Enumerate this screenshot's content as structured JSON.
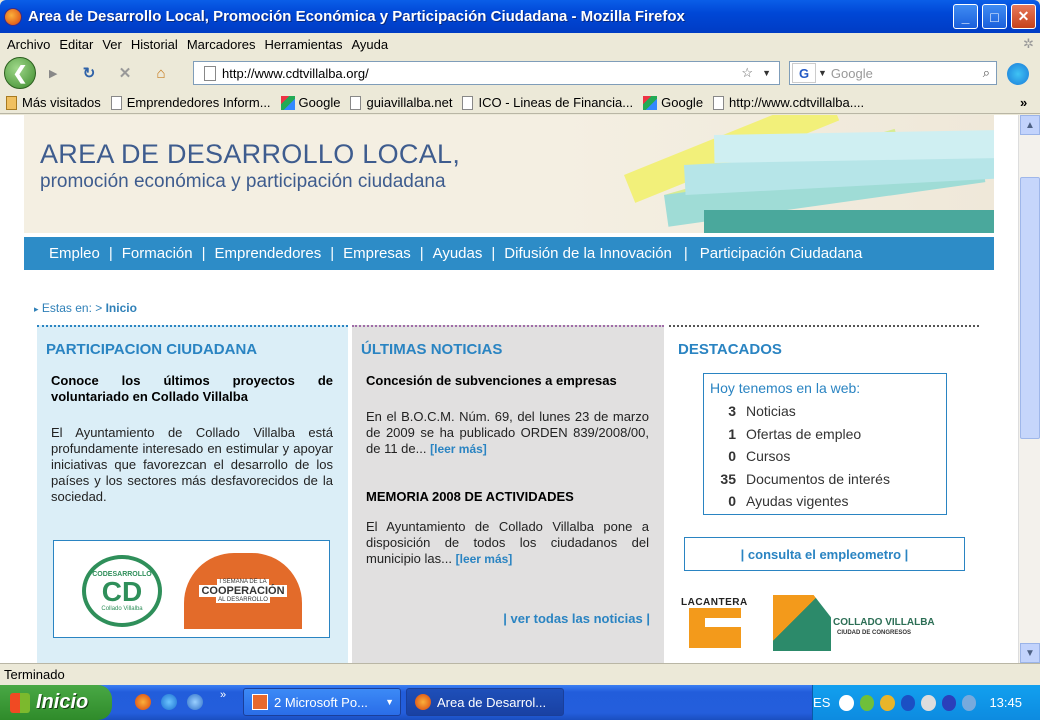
{
  "window": {
    "title": "Area de Desarrollo Local, Promoción Económica y Participación Ciudadana - Mozilla Firefox"
  },
  "menu": [
    "Archivo",
    "Editar",
    "Ver",
    "Historial",
    "Marcadores",
    "Herramientas",
    "Ayuda"
  ],
  "navigation": {
    "url": "http://www.cdtvillalba.org/",
    "search_placeholder": "Google"
  },
  "bookmarks": [
    {
      "label": "Más visitados",
      "icon": "folder-icon"
    },
    {
      "label": "Emprendedores Inform...",
      "icon": "page-icon"
    },
    {
      "label": "Google",
      "icon": "google-icon"
    },
    {
      "label": "guiavillalba.net",
      "icon": "page-icon"
    },
    {
      "label": "ICO - Lineas de Financia...",
      "icon": "page-icon"
    },
    {
      "label": "Google",
      "icon": "google-icon"
    },
    {
      "label": "http://www.cdtvillalba....",
      "icon": "page-icon"
    }
  ],
  "banner": {
    "title": "AREA DE DESARROLLO LOCAL,",
    "subtitle": "promoción económica y participación ciudadana"
  },
  "topnav": [
    "Empleo",
    "Formación",
    "Emprendedores",
    "Empresas",
    "Ayudas",
    "Difusión de la Innovación",
    "Participación Ciudadana"
  ],
  "breadcrumb": {
    "prefix": "Estas en: >",
    "current": "Inicio"
  },
  "participacion": {
    "heading": "PARTICIPACION CIUDADANA",
    "title": "Conoce los últimos proyectos de voluntariado en Collado Villalba",
    "body": "El Ayuntamiento de Collado Villalba está profundamente interesado en estimular y apoyar iniciativas que favorezcan el desarrollo de los países y los sectores más desfavorecidos de la sociedad.",
    "logo1_text": "CODESARROLLO",
    "logo1_sub": "Collado Villalba",
    "logo2_top": "I SEMANA DE LA",
    "logo2_main": "COOPERACIÓN",
    "logo2_sub": "AL DESARROLLO"
  },
  "noticias": {
    "heading": "ÚLTIMAS NOTICIAS",
    "items": [
      {
        "title": "Concesión de subvenciones a empresas",
        "body": "En el B.O.C.M. Núm. 69, del lunes 23 de marzo de 2009 se ha publicado ORDEN 839/2008/00, de 11 de...",
        "more": "[leer más]"
      },
      {
        "title": "MEMORIA 2008 DE ACTIVIDADES",
        "body": "El Ayuntamiento de Collado Villalba pone a disposición de todos los ciudadanos del municipio las...",
        "more": "[leer más]"
      }
    ],
    "all_link": "| ver todas las noticias |"
  },
  "destacados": {
    "heading": "DESTACADOS",
    "box_title": "Hoy tenemos en la web:",
    "stats": [
      {
        "count": "3",
        "label": "Noticias"
      },
      {
        "count": "1",
        "label": "Ofertas de empleo"
      },
      {
        "count": "0",
        "label": "Cursos"
      },
      {
        "count": "35",
        "label": "Documentos de interés"
      },
      {
        "count": "0",
        "label": "Ayudas vigentes"
      }
    ],
    "consulta": "| consulta el empleometro |",
    "logo_lacantera": "LACANTERA",
    "logo_collado": "COLLADO VILLALBA",
    "logo_collado_sub": "CIUDAD DE CONGRESOS"
  },
  "status": "Terminado",
  "taskbar": {
    "start": "Inicio",
    "tasks": [
      "2 Microsoft Po...",
      "Area de Desarrol..."
    ],
    "lang": "ES",
    "clock": "13:45"
  },
  "colors": {
    "accent": "#2a84c2",
    "nav_bg": "#2d8cc7",
    "banner_text": "#3e5c8e"
  }
}
